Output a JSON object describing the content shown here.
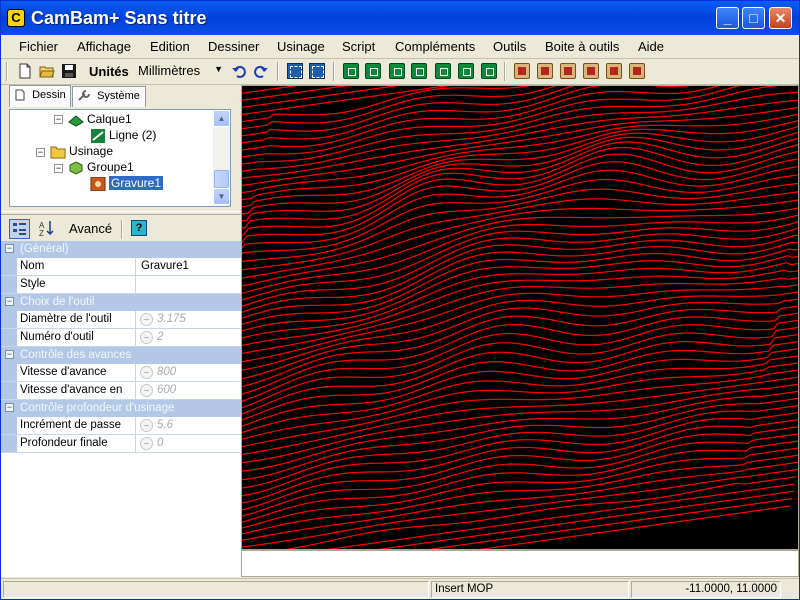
{
  "window": {
    "title": "CamBam+  Sans titre",
    "minimize": "_",
    "maximize": "□",
    "close": "✕"
  },
  "menu": [
    "Fichier",
    "Affichage",
    "Edition",
    "Dessiner",
    "Usinage",
    "Script",
    "Compléments",
    "Outils",
    "Boite à outils",
    "Aide"
  ],
  "toolbar": {
    "units_label": "Unités",
    "units_value": "Millimètres",
    "icons": [
      "new-file-icon",
      "open-folder-icon",
      "save-icon",
      "undo-icon",
      "redo-icon",
      "snap-point-icon",
      "grid-icon",
      "profile-icon",
      "pocket-icon",
      "drill-icon",
      "engrave-icon",
      "text-icon",
      "lathe-icon",
      "3d-profile-icon",
      "mop-style-icon",
      "settings-icon",
      "tool-library-icon",
      "material-icon",
      "post-processor-icon"
    ]
  },
  "tabs": {
    "dessin": "Dessin",
    "systeme": "Système"
  },
  "tree": {
    "calque": "Calque1",
    "ligne": "Ligne (2)",
    "usinage": "Usinage",
    "groupe": "Groupe1",
    "gravure": "Gravure1"
  },
  "prop_toolbar": {
    "advanced": "Avancé",
    "help": "?"
  },
  "properties": {
    "cat_general": "(Général)",
    "nom_label": "Nom",
    "nom_value": "Gravure1",
    "style_label": "Style",
    "style_value": "",
    "cat_outil": "Choix de l'outil",
    "diametre_label": "Diamètre de l'outil",
    "diametre_value": "3.175",
    "numero_label": "Numéro d'outil",
    "numero_value": "2",
    "cat_avances": "Contrôle des avances",
    "vitesse_label": "Vitesse d'avance",
    "vitesse_value": "800",
    "vitesse_en_label": "Vitesse d'avance en",
    "vitesse_en_value": "600",
    "cat_profondeur": "Contrôle profondeur d'usinage",
    "increment_label": "Incrément de passe",
    "increment_value": "5.6",
    "profondeur_label": "Profondeur finale",
    "profondeur_value": "0"
  },
  "viewport": {
    "background": "#000000",
    "toolpath_color": "#ff0000"
  },
  "status": {
    "mode": "Insert MOP",
    "coords": "-11.0000, 11.0000"
  }
}
